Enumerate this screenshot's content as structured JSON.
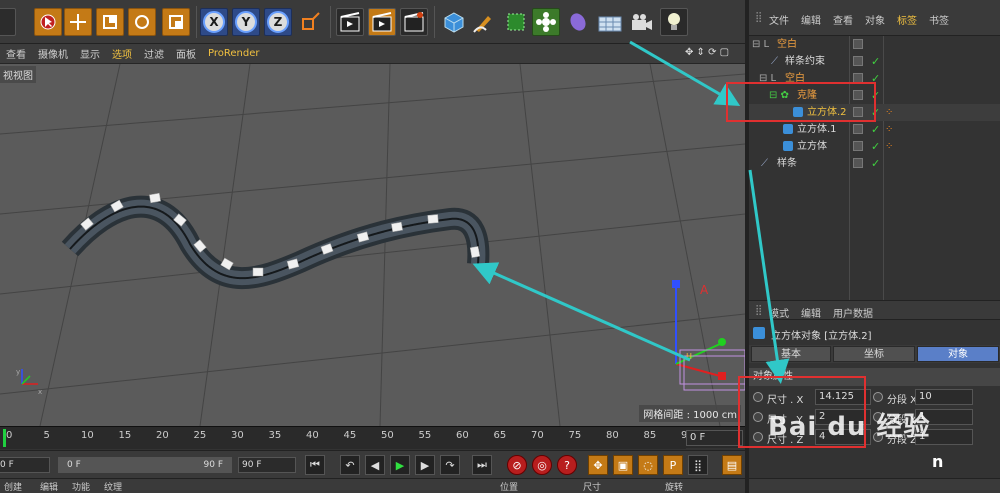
{
  "toolbar": {
    "icons": [
      "pointer-icon",
      "move-icon",
      "scale-icon",
      "rotate-icon",
      "scale-2-icon",
      "x-axis-icon",
      "y-axis-icon",
      "z-axis-icon",
      "coordinate-system-icon",
      "render-view-icon",
      "render-picture-queue-icon",
      "render-settings-icon",
      "cube-icon",
      "pen-icon",
      "subdivision-icon",
      "cloner-icon",
      "deformer-icon",
      "floor-icon",
      "camera-icon",
      "light-icon"
    ],
    "axis_labels": [
      "X",
      "Y",
      "Z"
    ]
  },
  "viewport_menu": {
    "items": [
      "查看",
      "摄像机",
      "显示",
      "选项",
      "过滤",
      "面板",
      "ProRender"
    ],
    "active": "选项"
  },
  "viewport": {
    "tag": "视视图",
    "grid_info": "网格间距 : 1000 cm"
  },
  "timeline": {
    "ticks": [
      "0",
      "5",
      "10",
      "15",
      "20",
      "25",
      "30",
      "35",
      "40",
      "45",
      "50",
      "55",
      "60",
      "65",
      "70",
      "75",
      "80",
      "85",
      "90"
    ],
    "current_frame_field": "0 F"
  },
  "transport": {
    "start_field": "0 F",
    "range_start": "0 F",
    "range_end": "90 F",
    "end_field": "90 F"
  },
  "bottom_bar": {
    "items": [
      "创建",
      "编辑",
      "功能",
      "纹理"
    ],
    "coord_labels": [
      "位置",
      "尺寸",
      "旋转"
    ]
  },
  "object_manager": {
    "menu": [
      "文件",
      "编辑",
      "查看",
      "对象",
      "标签",
      "书签"
    ],
    "active_menu": "标签",
    "rows": [
      {
        "label": "空白",
        "type": "null"
      },
      {
        "label": "样条约束",
        "type": "tag"
      },
      {
        "label": "空白",
        "type": "null"
      },
      {
        "label": "克隆",
        "type": "cloner"
      },
      {
        "label": "立方体.2",
        "type": "cube",
        "selected": true
      },
      {
        "label": "立方体.1",
        "type": "cube"
      },
      {
        "label": "立方体",
        "type": "cube"
      },
      {
        "label": "样条",
        "type": "spline"
      }
    ]
  },
  "attributes": {
    "header_tabs": [
      "模式",
      "编辑",
      "用户数据"
    ],
    "title": "立方体对象 [立方体.2]",
    "tabs": [
      "基本",
      "坐标",
      "对象"
    ],
    "active_tab": "对象",
    "section": "对象属性",
    "params": [
      {
        "label": "尺寸 . X",
        "value": "14.125",
        "seg_label": "分段 X",
        "seg_value": "10"
      },
      {
        "label": "尺寸 . Y",
        "value": "2",
        "seg_label": "分段 Y",
        "seg_value": "1"
      },
      {
        "label": "尺寸 . Z",
        "value": "4",
        "seg_label": "分段 Z",
        "seg_value": "1"
      }
    ]
  },
  "watermark": {
    "text": "Bai du 经验",
    "sub": "n"
  },
  "colors": {
    "accent": "#f0c040",
    "highlight_box": "#e03030",
    "arrow": "#30c8c8",
    "active_tab": "#5a7fc8"
  }
}
